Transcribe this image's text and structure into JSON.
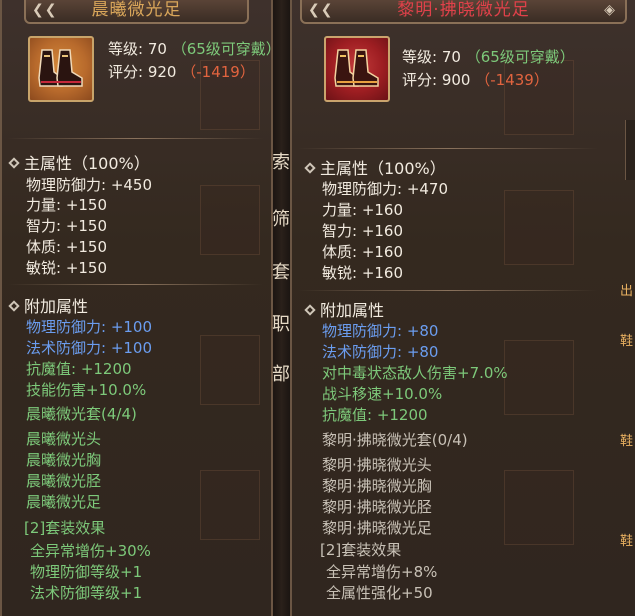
{
  "left": {
    "title": "晨曦微光足",
    "level_line": "等级: 70",
    "wear_note": "（65级可穿戴）",
    "score_line": "评分: 920",
    "score_diff": "（-1419）",
    "main_attr_header": "主属性（100%）",
    "main_attrs": [
      "物理防御力: +450",
      "力量: +150",
      "智力: +150",
      "体质: +150",
      "敏锐: +150"
    ],
    "extra_header": "附加属性",
    "extra_blue": [
      "物理防御力: +100",
      "法术防御力: +100"
    ],
    "extra_green": [
      "抗魔值: +1200",
      "技能伤害+10.0%"
    ],
    "set_name": "晨曦微光套(4/4)",
    "set_items": [
      "晨曦微光头",
      "晨曦微光胸",
      "晨曦微光胫",
      "晨曦微光足"
    ],
    "set_effect_header": "[2]套装效果",
    "set_effects": [
      "全异常增伤+30%",
      "物理防御等级+1",
      "法术防御等级+1"
    ]
  },
  "right": {
    "title": "黎明·拂晓微光足",
    "level_line": "等级: 70",
    "wear_note": "（65级可穿戴）",
    "score_line": "评分: 900",
    "score_diff": "（-1439）",
    "main_attr_header": "主属性（100%）",
    "main_attrs": [
      "物理防御力: +470",
      "力量: +160",
      "智力: +160",
      "体质: +160",
      "敏锐: +160"
    ],
    "extra_header": "附加属性",
    "extra_blue": [
      "物理防御力: +80",
      "法术防御力: +80"
    ],
    "extra_green": [
      "对中毒状态敌人伤害+7.0%",
      "战斗移速+10.0%",
      "抗魔值: +1200"
    ],
    "set_name": "黎明·拂晓微光套(0/4)",
    "set_items": [
      "黎明·拂晓微光头",
      "黎明·拂晓微光胸",
      "黎明·拂晓微光胫",
      "黎明·拂晓微光足"
    ],
    "set_effect_header": "[2]套装效果",
    "set_effects": [
      "全异常增伤+8%",
      "全属性强化+50"
    ]
  },
  "background_fragments": {
    "middle_chars": [
      "索",
      "筛",
      "套",
      "职",
      "部"
    ],
    "right_edge_chars": [
      "出",
      "鞋",
      "鞋",
      "鞋"
    ]
  },
  "colors": {
    "title_left": "#d9a65a",
    "title_right": "#e0414a",
    "green": "#7dc97a",
    "blue": "#6b9df0",
    "orange": "#e2643f",
    "white": "#f2ebe0"
  }
}
